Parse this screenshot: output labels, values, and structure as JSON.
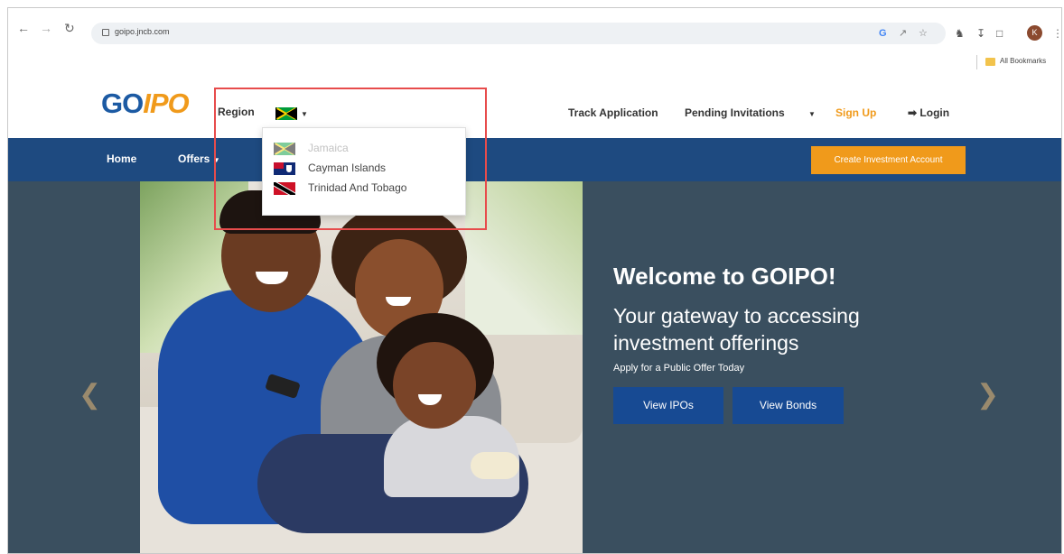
{
  "browser": {
    "back_icon": "arrow-left-icon",
    "forward_icon": "arrow-right-icon",
    "reload_icon": "reload-icon",
    "url": "goipo.jncb.com",
    "bookmarks_label": "All Bookmarks",
    "avatar_initial": "K"
  },
  "site": {
    "logo_go": "GO",
    "logo_ipo": "IPO",
    "region_label": "Region",
    "selected_region": "Jamaica",
    "nav": {
      "track": "Track Application",
      "pending": "Pending Invitations",
      "signup": "Sign Up",
      "login": "Login"
    },
    "menu": {
      "home": "Home",
      "offers": "Offers",
      "cta": "Create Investment Account"
    },
    "region_options": [
      {
        "label": "Jamaica",
        "flag": "jamaica-flag",
        "disabled": true
      },
      {
        "label": "Cayman Islands",
        "flag": "cayman-islands-flag",
        "disabled": false
      },
      {
        "label": "Trinidad And Tobago",
        "flag": "trinidad-and-tobago-flag",
        "disabled": false
      }
    ]
  },
  "hero": {
    "title": "Welcome to GOIPO!",
    "subtitle": "Your gateway to accessing investment offerings",
    "note": "Apply for a Public Offer Today",
    "btn_ipos": "View IPOs",
    "btn_bonds": "View Bonds"
  },
  "colors": {
    "brand_blue": "#1e4a80",
    "brand_orange": "#f09a1b",
    "hero_bg": "#3a4f5f",
    "highlight": "#e74c4c"
  }
}
